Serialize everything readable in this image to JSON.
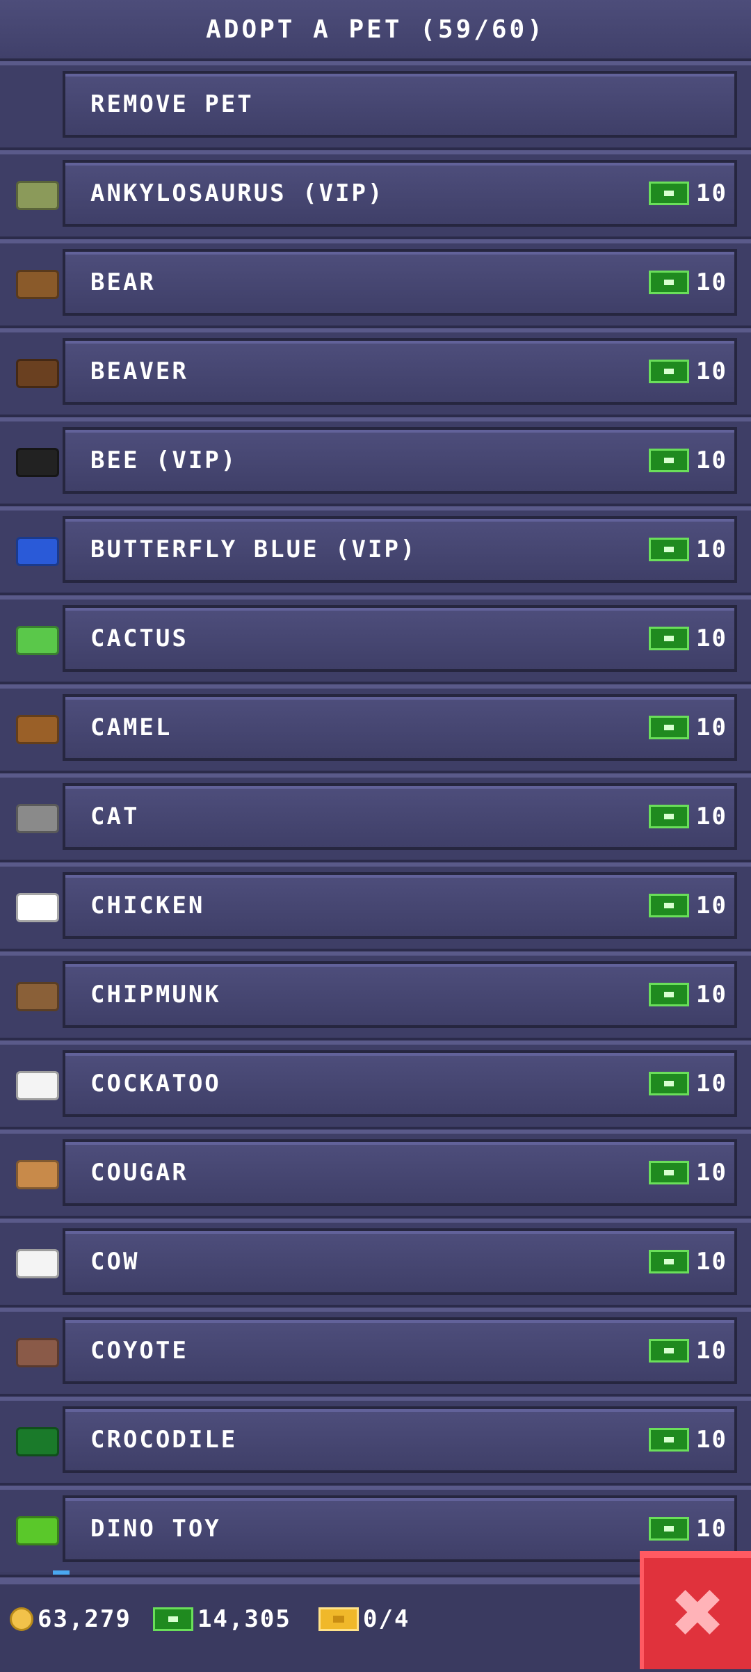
{
  "header": {
    "title": "ADOPT A PET (59/60)"
  },
  "remove_label": "REMOVE PET",
  "pets": [
    {
      "name": "ANKYLOSAURUS (VIP)",
      "price": "10",
      "icon": "ankylosaurus-icon",
      "color": "#8b9a5a"
    },
    {
      "name": "BEAR",
      "price": "10",
      "icon": "bear-icon",
      "color": "#8a5a2a"
    },
    {
      "name": "BEAVER",
      "price": "10",
      "icon": "beaver-icon",
      "color": "#6a4020"
    },
    {
      "name": "BEE (VIP)",
      "price": "10",
      "icon": "bee-icon",
      "color": "#222222"
    },
    {
      "name": "BUTTERFLY BLUE (VIP)",
      "price": "10",
      "icon": "butterfly-icon",
      "color": "#2a5ad8"
    },
    {
      "name": "CACTUS",
      "price": "10",
      "icon": "cactus-icon",
      "color": "#5ac84a"
    },
    {
      "name": "CAMEL",
      "price": "10",
      "icon": "camel-icon",
      "color": "#9a6028"
    },
    {
      "name": "CAT",
      "price": "10",
      "icon": "cat-icon",
      "color": "#8a8a8a"
    },
    {
      "name": "CHICKEN",
      "price": "10",
      "icon": "chicken-icon",
      "color": "#ffffff"
    },
    {
      "name": "CHIPMUNK",
      "price": "10",
      "icon": "chipmunk-icon",
      "color": "#8a6038"
    },
    {
      "name": "COCKATOO",
      "price": "10",
      "icon": "cockatoo-icon",
      "color": "#f4f4f4"
    },
    {
      "name": "COUGAR",
      "price": "10",
      "icon": "cougar-icon",
      "color": "#c88a4a"
    },
    {
      "name": "COW",
      "price": "10",
      "icon": "cow-icon",
      "color": "#f4f4f4"
    },
    {
      "name": "COYOTE",
      "price": "10",
      "icon": "coyote-icon",
      "color": "#8a5a48"
    },
    {
      "name": "CROCODILE",
      "price": "10",
      "icon": "crocodile-icon",
      "color": "#1a7a2a"
    },
    {
      "name": "DINO TOY",
      "price": "10",
      "icon": "dino-toy-icon",
      "color": "#5ac82a"
    }
  ],
  "footer": {
    "coins": "63,279",
    "cash": "14,305",
    "tickets": "0/4"
  }
}
